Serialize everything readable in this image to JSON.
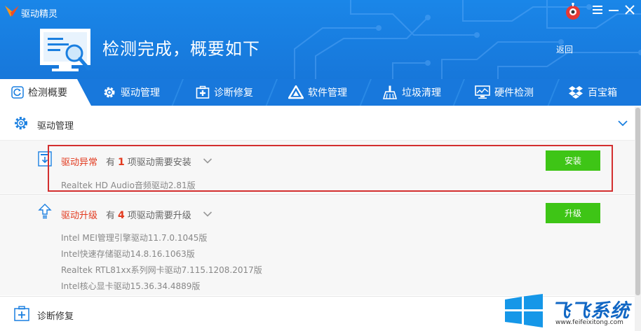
{
  "app": {
    "title": "驱动精灵"
  },
  "header": {
    "headline": "检测完成，概要如下",
    "back": "返回"
  },
  "tabs": [
    {
      "label": "检测概要",
      "icon": "refresh-icon"
    },
    {
      "label": "驱动管理",
      "icon": "gear-icon"
    },
    {
      "label": "诊断修复",
      "icon": "medkit-icon"
    },
    {
      "label": "软件管理",
      "icon": "software-icon"
    },
    {
      "label": "垃圾清理",
      "icon": "broom-icon"
    },
    {
      "label": "硬件检测",
      "icon": "monitor-icon"
    },
    {
      "label": "百宝箱",
      "icon": "dropbox-icon"
    }
  ],
  "driver_section": {
    "title": "驱动管理"
  },
  "abnormal": {
    "title": "驱动异常",
    "prefix": "有",
    "count": "1",
    "suffix": "项驱动需要安装",
    "button": "安装",
    "items": [
      "Realtek HD Audio音频驱动2.81版"
    ]
  },
  "upgrade": {
    "title": "驱动升级",
    "prefix": "有",
    "count": "4",
    "suffix": "项驱动需要升级",
    "button": "升级",
    "items": [
      "Intel MEI管理引擎驱动11.7.0.1045版",
      "Intel快速存储驱动14.8.16.1063版",
      "Realtek RTL81xx系列网卡驱动7.115.1208.2017版",
      "Intel核心显卡驱动15.36.34.4889版"
    ]
  },
  "diag_section": {
    "title": "诊断修复"
  },
  "watermark": {
    "text": "飞飞系统",
    "url": "www.feifeixitong.com"
  }
}
